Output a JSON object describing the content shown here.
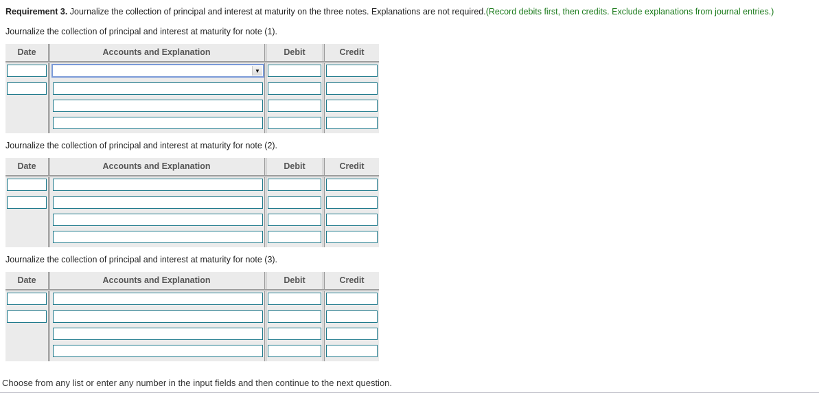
{
  "requirement": {
    "label": "Requirement 3.",
    "text": " Journalize the collection of principal and interest at maturity on the three notes. Explanations are not required.",
    "instruction": "(Record debits first, then credits. Exclude explanations from journal entries.)"
  },
  "columns": {
    "date": "Date",
    "accounts": "Accounts and Explanation",
    "debit": "Debit",
    "credit": "Credit"
  },
  "notes": [
    {
      "heading": "Journalize the collection of principal and interest at maturity for note (1).",
      "rows": [
        {
          "date": "",
          "account": "",
          "debit": "",
          "credit": ""
        },
        {
          "date": "",
          "account": "",
          "debit": "",
          "credit": ""
        },
        {
          "account": "",
          "debit": "",
          "credit": ""
        },
        {
          "account": "",
          "debit": "",
          "credit": ""
        }
      ]
    },
    {
      "heading": "Journalize the collection of principal and interest at maturity for note (2).",
      "rows": [
        {
          "date": "",
          "account": "",
          "debit": "",
          "credit": ""
        },
        {
          "date": "",
          "account": "",
          "debit": "",
          "credit": ""
        },
        {
          "account": "",
          "debit": "",
          "credit": ""
        },
        {
          "account": "",
          "debit": "",
          "credit": ""
        }
      ]
    },
    {
      "heading": "Journalize the collection of principal and interest at maturity for note (3).",
      "rows": [
        {
          "date": "",
          "account": "",
          "debit": "",
          "credit": ""
        },
        {
          "date": "",
          "account": "",
          "debit": "",
          "credit": ""
        },
        {
          "account": "",
          "debit": "",
          "credit": ""
        },
        {
          "account": "",
          "debit": "",
          "credit": ""
        }
      ]
    }
  ],
  "dropdown_icon": "triangle-down-icon",
  "footer": {
    "text": "Choose from any list or enter any number in the input fields and then continue to the next question."
  },
  "colors": {
    "instruction_green": "#1b7a1b",
    "field_border": "#1f7a8c",
    "focused_border": "#7a9ad8",
    "table_bg": "#ebebeb"
  }
}
